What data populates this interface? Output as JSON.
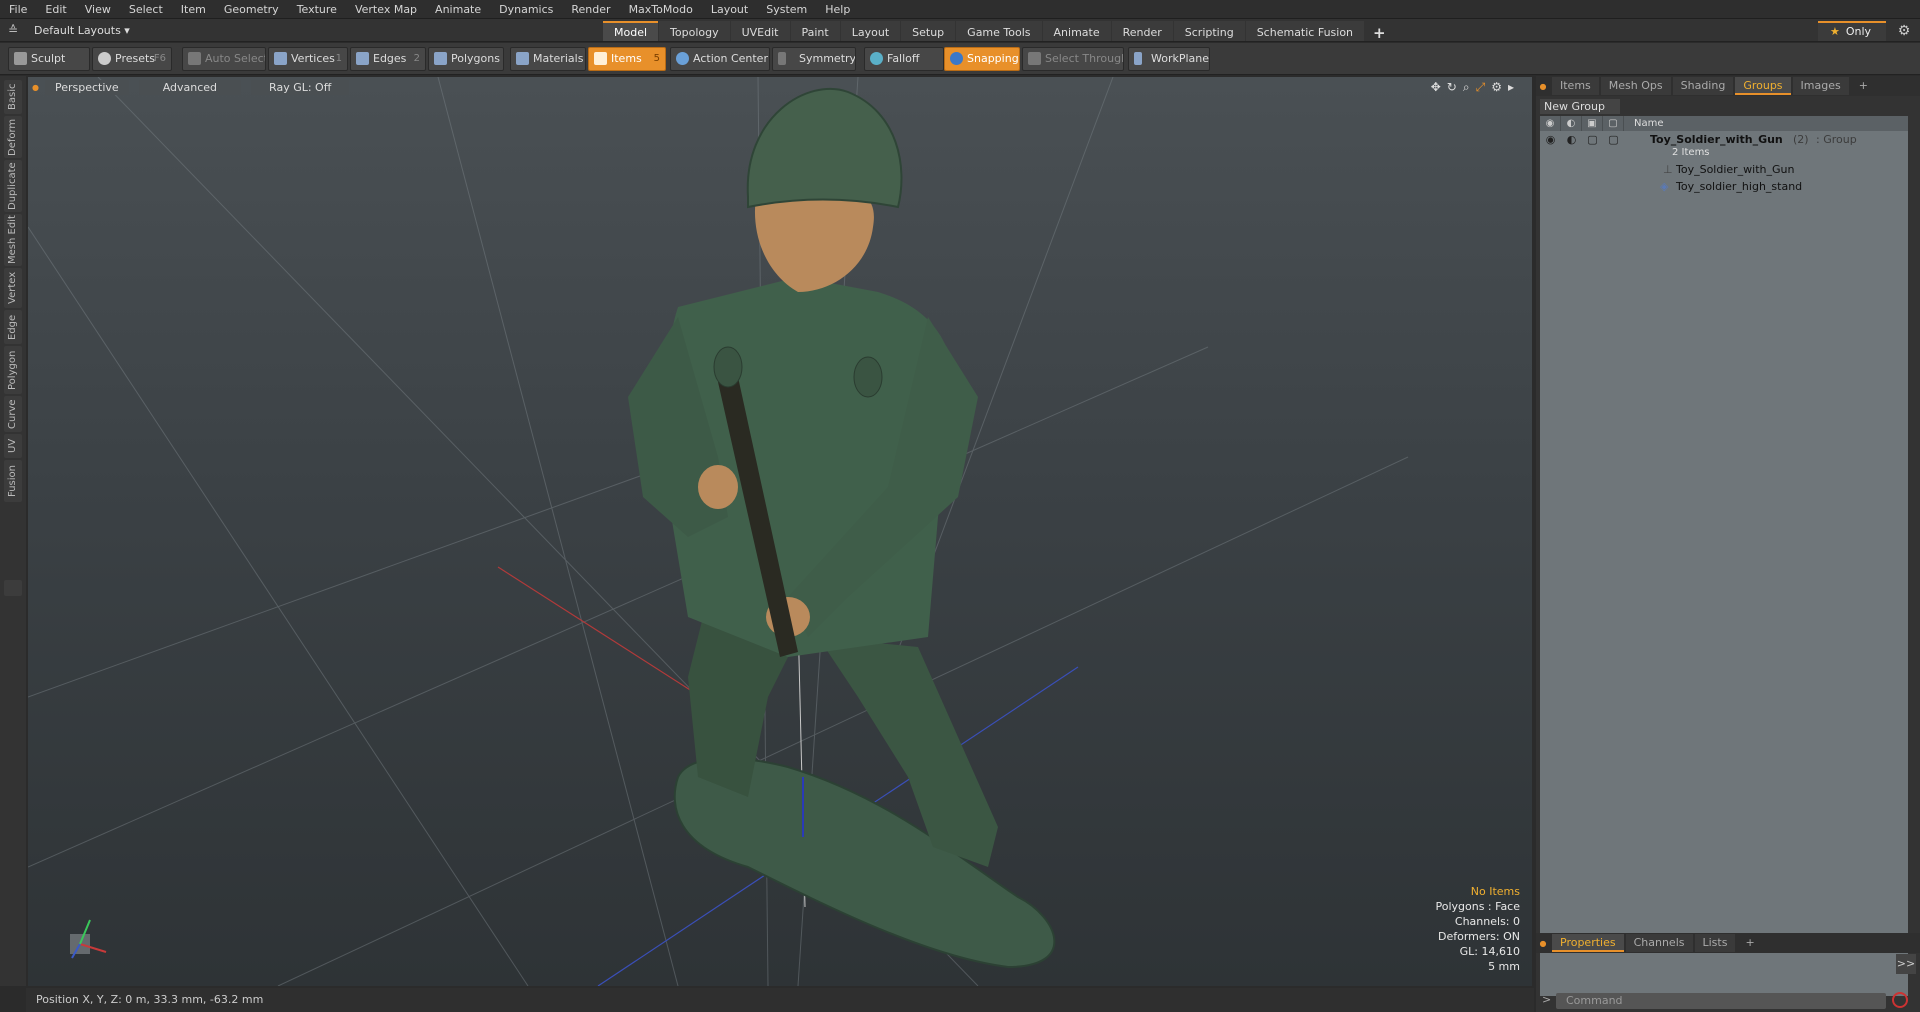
{
  "menu": [
    "File",
    "Edit",
    "View",
    "Select",
    "Item",
    "Geometry",
    "Texture",
    "Vertex Map",
    "Animate",
    "Dynamics",
    "Render",
    "MaxToModo",
    "Layout",
    "System",
    "Help"
  ],
  "layouts": {
    "label": "Default Layouts ▾"
  },
  "mode_tabs": [
    "Model",
    "Topology",
    "UVEdit",
    "Paint",
    "Layout",
    "Setup",
    "Game Tools",
    "Animate",
    "Render",
    "Scripting",
    "Schematic Fusion"
  ],
  "mode_tab_add": "+",
  "only_label": "Only",
  "toolbar": {
    "sculpt": "Sculpt",
    "presets": "Presets",
    "presets_key": "F6",
    "auto_select": "Auto Select",
    "vertices": "Vertices",
    "vertices_count": "1",
    "edges": "Edges",
    "edges_count": "2",
    "polygons": "Polygons",
    "materials": "Materials",
    "items": "Items",
    "items_count": "5",
    "action_center": "Action Center",
    "symmetry": "Symmetry",
    "falloff": "Falloff",
    "snapping": "Snapping",
    "select_through": "Select Through",
    "workplane": "WorkPlane"
  },
  "left_tabs": [
    "Basic",
    "Deform",
    "Duplicate",
    "Mesh Edit",
    "Vertex",
    "Edge",
    "Polygon",
    "Curve",
    "UV",
    "Fusion"
  ],
  "viewport": {
    "perspective": "Perspective",
    "advanced": "Advanced",
    "raygl": "Ray GL: Off"
  },
  "hud": {
    "line1": "No Items",
    "line2": "Polygons : Face",
    "line3": "Channels: 0",
    "line4": "Deformers: ON",
    "line5": "GL: 14,610",
    "line6": "5 mm"
  },
  "status": "Position X, Y, Z:   0 m, 33.3 mm, -63.2 mm",
  "right_tabs": [
    "Items",
    "Mesh Ops",
    "Shading",
    "Groups",
    "Images"
  ],
  "right_tab_add": "+",
  "new_group": "New Group",
  "table_header": {
    "name": "Name"
  },
  "groups": {
    "group_name": "Toy_Soldier_with_Gun",
    "group_count": "(2)",
    "group_type": ": Group",
    "group_items": "2 Items",
    "child1": "Toy_Soldier_with_Gun",
    "child2": "Toy_soldier_high_stand"
  },
  "bottom_tabs": [
    "Properties",
    "Channels",
    "Lists"
  ],
  "bottom_tab_add": "+",
  "expand_label": ">>",
  "command_placeholder": "Command",
  "colors": {
    "accent": "#e8902a",
    "soldier": "#3f5a48",
    "skin": "#b98a5c"
  }
}
